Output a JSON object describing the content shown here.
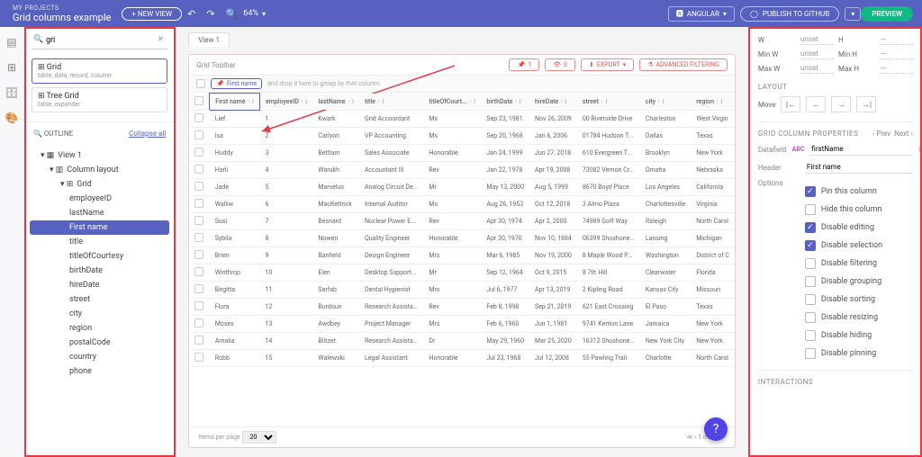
{
  "topbar": {
    "my_projects": "MY PROJECTS",
    "title": "Grid columns example",
    "new_view": "+ NEW VIEW",
    "zoom": "64%",
    "angular": "ANGULAR",
    "publish": "PUBLISH TO GITHUB",
    "preview": "PREVIEW"
  },
  "search": {
    "placeholder": "",
    "value": "gri"
  },
  "results": [
    {
      "title": "Grid",
      "sub": "table, data, record, column"
    },
    {
      "title": "Tree Grid",
      "sub": "table, expander"
    }
  ],
  "outline": {
    "label": "OUTLINE",
    "collapse": "Collapse all"
  },
  "tree": {
    "view": "View 1",
    "layout": "Column layout",
    "grid": "Grid",
    "nodes": [
      "employeeID",
      "lastName",
      "First name",
      "title",
      "titleOfCourtesy",
      "birthDate",
      "hireDate",
      "street",
      "city",
      "region",
      "postalCode",
      "country",
      "phone"
    ],
    "selected": "First name"
  },
  "view_tab": "View 1",
  "grid_toolbar": {
    "title": "Grid Toolbar",
    "pin_count": "1",
    "hide_count": "0",
    "export": "EXPORT",
    "filter": "ADVANCED FILTERING"
  },
  "group_hint": "and drop it here to group by that column.",
  "pin_pill": "First name",
  "columns": [
    "",
    "First name",
    "employeeID",
    "lastName",
    "title",
    "titleOfCourt...",
    "birthDate",
    "hireDate",
    "street",
    "city",
    "region"
  ],
  "rows": [
    [
      "Lief",
      "1",
      "Kwark",
      "Grid Accountant",
      "Ms",
      "Sep 23, 1981",
      "Nov 26, 2009",
      "00 Riverside Drive",
      "Charleston",
      "West Virgin"
    ],
    [
      "Isa",
      "2",
      "Carlyon",
      "VP Accounting",
      "Ms",
      "Sep 20, 1968",
      "Jan 6, 2006",
      "01784 Hudson T...",
      "Dallas",
      "Texas"
    ],
    [
      "Huddy",
      "3",
      "Bettlam",
      "Sales Associate",
      "Honorable",
      "Jan 24, 1999",
      "Jun 27, 2018",
      "610 Evergreen T...",
      "Brooklyn",
      "New York"
    ],
    [
      "Harli",
      "4",
      "Warukh",
      "Accountant III",
      "Rev",
      "Jan 22, 1978",
      "Apr 19, 2008",
      "73082 Vernon Cr...",
      "Omaha",
      "Nebraska"
    ],
    [
      "Jade",
      "5",
      "Marvelus",
      "Analog Circuit De...",
      "Mr",
      "May 13, 2000",
      "Aug 5, 1999",
      "8670 Boyd Place",
      "Los Angeles",
      "California"
    ],
    [
      "Walliw",
      "6",
      "MacKettrick",
      "Internal Auditor",
      "Ms",
      "Aug 26, 1953",
      "Oct 12, 2018",
      "3 Almo Plaza",
      "Charlottesville",
      "Virginia"
    ],
    [
      "Susi",
      "7",
      "Besnard",
      "Nuclear Power E...",
      "Rev",
      "Apr 30, 1974",
      "Apr 2, 2000",
      "74989 Goff Way",
      "Raleigh",
      "North Carol"
    ],
    [
      "Sybila",
      "8",
      "Nowen",
      "Quality Engineer",
      "Honorable",
      "Apr 30, 1970",
      "Nov 10, 1884",
      "06399 Shoshone...",
      "Lansing",
      "Michigan"
    ],
    [
      "Brien",
      "9",
      "Banfield",
      "Design Engineer",
      "Mrs",
      "Mar 6, 1985",
      "Nov 19, 2000",
      "8 Maple Wood P...",
      "Washington",
      "District of C"
    ],
    [
      "Winthrop",
      "10",
      "Elen",
      "Desktop Support...",
      "Mr",
      "Sep 12, 1964",
      "Oct 9, 2015",
      "8 7th Hill",
      "Clearwater",
      "Florida"
    ],
    [
      "Birgitta",
      "11",
      "Sarfab",
      "Dental Hygienist",
      "Mrs",
      "Jul 6, 1977",
      "Apr 13, 2019",
      "2 Kipling Road",
      "Kansas City",
      "Missouri"
    ],
    [
      "Flora",
      "12",
      "Burdoun",
      "Research Assista...",
      "Rev",
      "Feb 8, 1998",
      "Sep 21, 2019",
      "621 East Crossing",
      "El Paso",
      "Texas"
    ],
    [
      "Moses",
      "13",
      "Awdbey",
      "Project Manager",
      "Mrs",
      "Feb 6, 1960",
      "Jun 1, 1981",
      "9741 Kenton Lane",
      "Jamaica",
      "New York"
    ],
    [
      "Amalia",
      "14",
      "Blitzer",
      "Research Assista...",
      "Dr",
      "May 29, 1960",
      "Mar 25, 2020",
      "16312 Shoshone...",
      "New York City",
      "New York"
    ],
    [
      "Robb",
      "15",
      "Walewski",
      "Legal Assistant",
      "Honorable",
      "Jul 23, 1968",
      "Jul 12, 2008",
      "55 Pawling Trail",
      "Charlotte",
      "North Carol"
    ]
  ],
  "pager": {
    "label": "Items per page",
    "size": "20",
    "range": "1 of 4"
  },
  "size": {
    "w_label": "W",
    "w_val": "unset",
    "h_label": "H",
    "h_val": "---",
    "minw_label": "Min W",
    "minw_val": "unset",
    "minh_label": "Min H",
    "minh_val": "---",
    "maxw_label": "Max W",
    "maxw_val": "unset",
    "maxh_label": "Max H",
    "maxh_val": "---"
  },
  "layout": {
    "title": "LAYOUT",
    "move": "Move"
  },
  "props": {
    "title": "GRID COLUMN PROPERTIES",
    "prev": "Prev",
    "next": "Next",
    "datafield_label": "Datafield",
    "datafield_val": "firstName",
    "header_label": "Header",
    "header_val": "First name",
    "options_label": "Options",
    "opts": [
      {
        "label": "Pin this column",
        "on": true
      },
      {
        "label": "Hide this column",
        "on": false
      },
      {
        "label": "Disable editing",
        "on": true
      },
      {
        "label": "Disable selection",
        "on": true
      },
      {
        "label": "Disable filtering",
        "on": false
      },
      {
        "label": "Disable grouping",
        "on": false
      },
      {
        "label": "Disable sorting",
        "on": false
      },
      {
        "label": "Disable resizing",
        "on": false
      },
      {
        "label": "Disable hiding",
        "on": false
      },
      {
        "label": "Disable pinning",
        "on": false
      }
    ]
  },
  "interactions_title": "INTERACTIONS"
}
